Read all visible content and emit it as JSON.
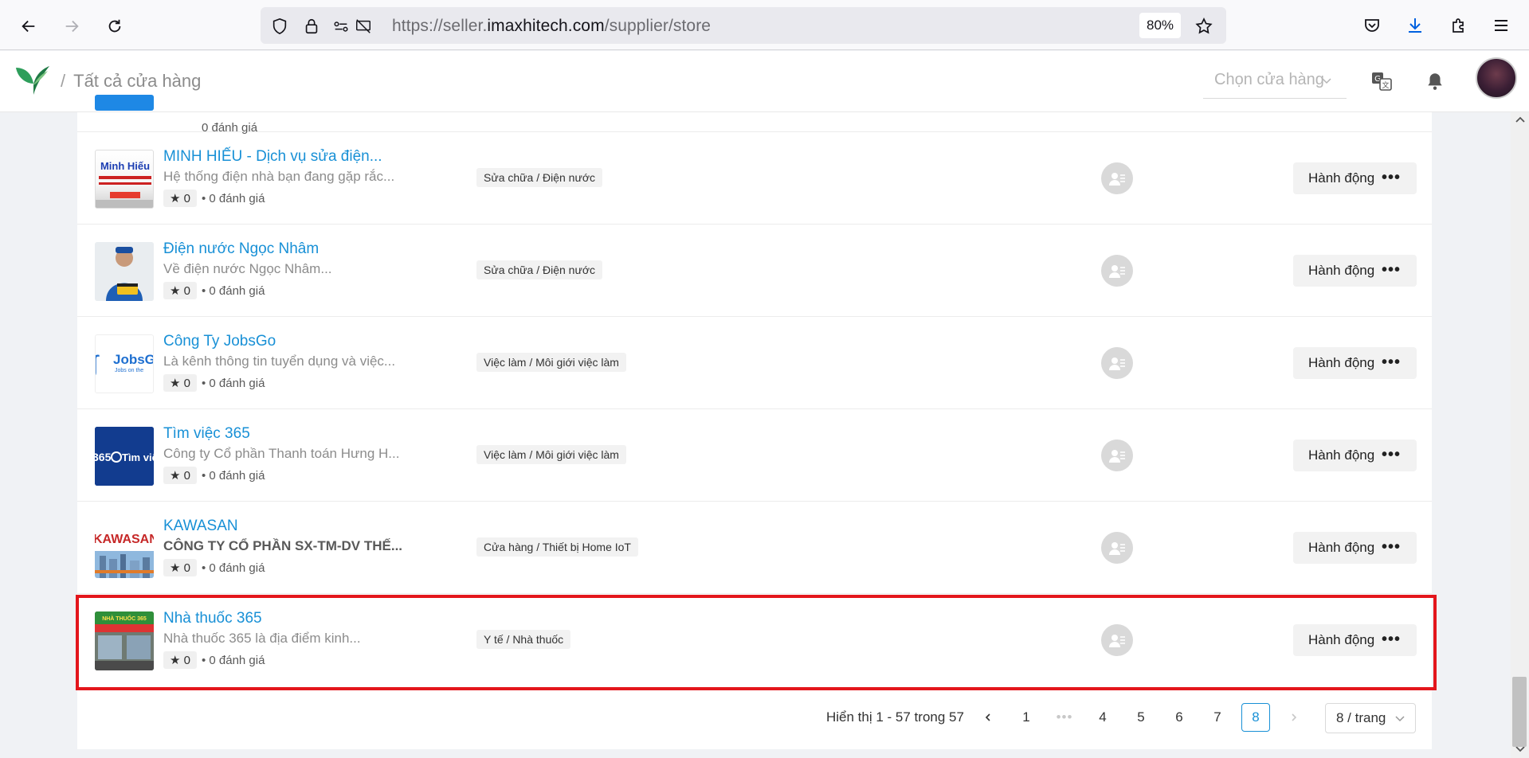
{
  "browser": {
    "url_prefix": "https://seller.",
    "url_domain": "imaxhitech.com",
    "url_path": "/supplier/store",
    "zoom": "80%"
  },
  "header": {
    "breadcrumb_sep": "/",
    "breadcrumb": "Tất cả cửa hàng",
    "store_select_placeholder": "Chọn cửa hàng"
  },
  "stores": [
    {
      "name": "MINH HIẾU - Dịch vụ sửa điện...",
      "description": "Hệ thống điện nhà bạn đang gặp rắc...",
      "rating": "0",
      "reviews": "• 0 đánh giá",
      "category": "Sửa chữa / Điện nước",
      "thumb_text": "Minh Hiếu",
      "action": "Hành động"
    },
    {
      "name": "Điện nước Ngọc Nhâm",
      "description": "Về điện nước Ngọc Nhâm...",
      "rating": "0",
      "reviews": "• 0 đánh giá",
      "category": "Sửa chữa / Điện nước",
      "thumb_text": "",
      "action": "Hành động"
    },
    {
      "name": "Công Ty JobsGo",
      "description": "Là kênh thông tin tuyển dụng và việc...",
      "rating": "0",
      "reviews": "• 0 đánh giá",
      "category": "Việc làm / Môi giới việc làm",
      "thumb_text": "JobsG",
      "action": "Hành động"
    },
    {
      "name": "Tìm việc 365",
      "description": "Công ty Cổ phần Thanh toán Hưng H...",
      "rating": "0",
      "reviews": "• 0 đánh giá",
      "category": "Việc làm / Môi giới việc làm",
      "thumb_text": "365 Tìm việ",
      "action": "Hành động"
    },
    {
      "name": "KAWASAN",
      "description": "CÔNG TY CỔ PHẦN SX-TM-DV THẾ...",
      "rating": "0",
      "reviews": "• 0 đánh giá",
      "category": "Cửa hàng / Thiết bị Home IoT",
      "thumb_text": "KAWASAN",
      "action": "Hành động"
    },
    {
      "name": "Nhà thuốc 365",
      "description": "Nhà thuốc 365 là địa điểm kinh...",
      "rating": "0",
      "reviews": "• 0 đánh giá",
      "category": "Y tế / Nhà thuốc",
      "thumb_text": "NHÀ THUỐC 365",
      "action": "Hành động"
    }
  ],
  "partial_top_row": {
    "reviews": "0 đánh giá"
  },
  "pagination": {
    "summary": "Hiển thị 1 - 57 trong 57",
    "pages": [
      "1",
      "•••",
      "4",
      "5",
      "6",
      "7",
      "8"
    ],
    "current_page": "8",
    "page_size": "8 / trang"
  },
  "colors": {
    "accent": "#1890d6",
    "highlight": "#e3161c"
  }
}
